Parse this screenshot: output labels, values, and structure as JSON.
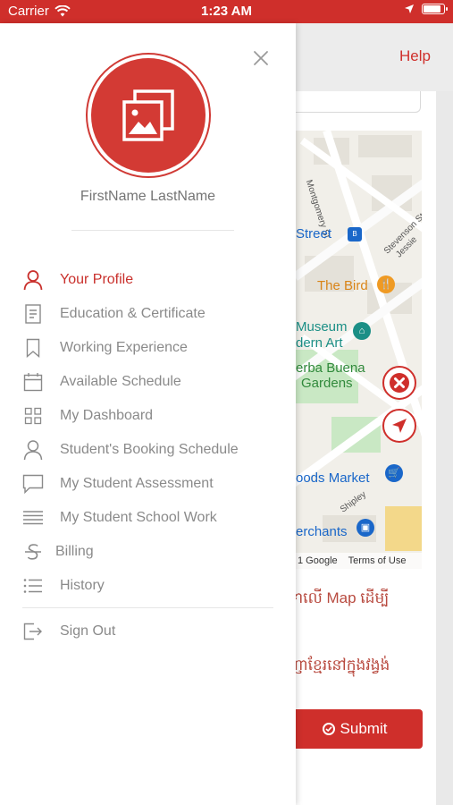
{
  "status_bar": {
    "carrier": "Carrier",
    "time": "1:23 AM",
    "battery_level": 0.9
  },
  "background": {
    "help_label": "Help",
    "map": {
      "streets": [
        "Montgomery St",
        "Street",
        "Stevenson St",
        "Jessie",
        "Shipley"
      ],
      "places": [
        "The Bird",
        "Museum",
        "dern Art",
        "erba Buena",
        "Gardens",
        "oods Market",
        "erchants"
      ],
      "attribution": "1 Google",
      "terms": "Terms of Use"
    },
    "khmer_line_1": "ទាលើ Map ដើម្បី",
    "khmer_line_2": "ញាខ្មែរនៅក្នុងវង្វង់",
    "submit_label": "Submit"
  },
  "drawer": {
    "user_name": "FirstName LastName",
    "menu": [
      {
        "label": "Your Profile",
        "icon": "user-icon",
        "active": true
      },
      {
        "label": "Education & Certificate",
        "icon": "document-icon",
        "active": false
      },
      {
        "label": "Working Experience",
        "icon": "bookmark-icon",
        "active": false
      },
      {
        "label": "Available Schedule",
        "icon": "calendar-icon",
        "active": false
      },
      {
        "label": "My Dashboard",
        "icon": "grid-icon",
        "active": false
      },
      {
        "label": "Student's Booking Schedule",
        "icon": "user-icon",
        "active": false
      },
      {
        "label": "My Student Assessment",
        "icon": "chat-bubble-icon",
        "active": false
      },
      {
        "label": "My Student School Work",
        "icon": "lines-icon",
        "active": false
      },
      {
        "label": "Billing",
        "icon": "strikethrough-s-icon",
        "active": false
      },
      {
        "label": "History",
        "icon": "list-icon",
        "active": false
      }
    ],
    "sign_out_label": "Sign Out"
  },
  "colors": {
    "brand_red": "#cf2f2b",
    "menu_gray": "#8a8a8a",
    "active_red": "#c9302c"
  }
}
